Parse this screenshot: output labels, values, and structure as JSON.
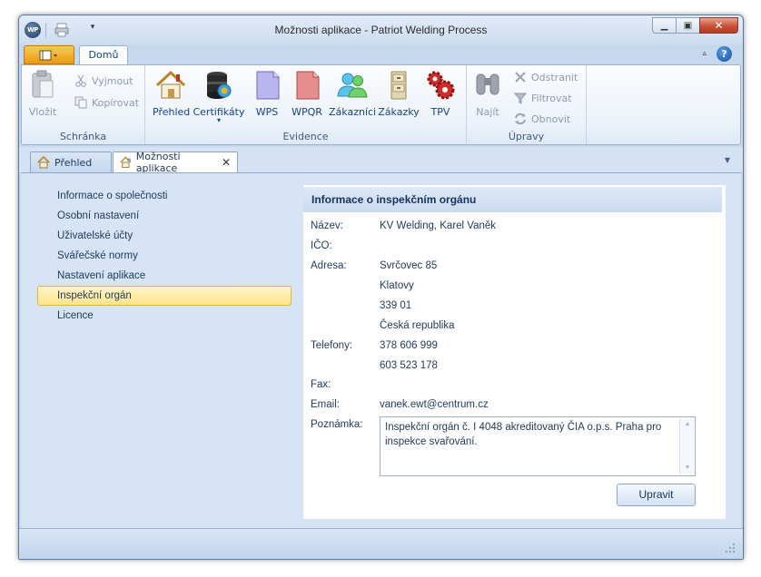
{
  "window": {
    "title": "Možnosti aplikace - Patriot Welding Process",
    "logo_text": "WP",
    "colors": {
      "accent": "#15428b",
      "selection": "#ffe38a",
      "close": "#c75136"
    }
  },
  "ribbon": {
    "tab_label": "Domů",
    "groups": {
      "clipboard": {
        "label": "Schránka",
        "paste": "Vložit",
        "cut": "Vyjmout",
        "copy": "Kopírovat"
      },
      "evidence": {
        "label": "Evidence",
        "overview": "Přehled",
        "certificates": "Certifikáty",
        "wps": "WPS",
        "wpqr": "WPQR",
        "customers": "Zákazníci",
        "orders": "Zákazky",
        "tpv": "TPV"
      },
      "edit": {
        "label": "Úpravy",
        "find": "Najít",
        "remove": "Odstranit",
        "filter": "Filtrovat",
        "refresh": "Obnovit"
      }
    }
  },
  "doc_tabs": [
    {
      "label": "Přehled"
    },
    {
      "label": "Možnosti aplikace"
    }
  ],
  "nav": {
    "items": [
      "Informace o společnosti",
      "Osobní nastavení",
      "Uživatelské účty",
      "Svářečské normy",
      "Nastavení aplikace",
      "Inspekční orgán",
      "Licence"
    ],
    "selected": "Inspekční orgán"
  },
  "panel": {
    "title": "Informace o inspekčním orgánu",
    "labels": {
      "name": "Název:",
      "ico": "IČO:",
      "address": "Adresa:",
      "phones": "Telefony:",
      "fax": "Fax:",
      "email": "Email:",
      "note": "Poznámka:"
    },
    "values": {
      "name": "KV Welding, Karel Vaněk",
      "ico": "",
      "address_line1": "Svrčovec 85",
      "address_line2": "Klatovy",
      "address_line3": "339 01",
      "address_line4": "Česká republika",
      "phone1": "378 606 999",
      "phone2": "603 523 178",
      "fax": "",
      "email": "vanek.ewt@centrum.cz",
      "note": "Inspekční orgán č. I 4048 akreditovaný ČIA o.p.s. Praha pro inspekce svařování."
    },
    "edit_button": "Upravit"
  }
}
